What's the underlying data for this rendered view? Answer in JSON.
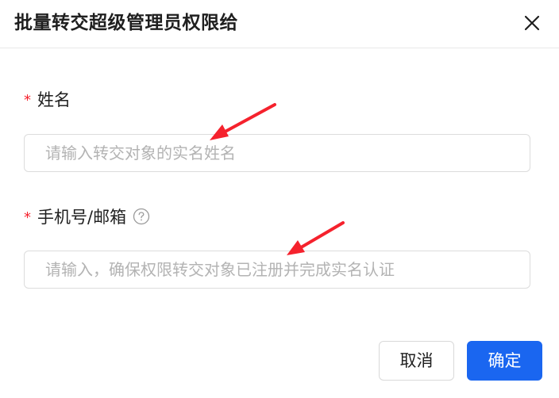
{
  "dialog": {
    "title": "批量转交超级管理员权限给",
    "close_icon": "close-icon"
  },
  "form": {
    "name_field": {
      "required_mark": "*",
      "label": "姓名",
      "placeholder": "请输入转交对象的实名姓名",
      "value": ""
    },
    "contact_field": {
      "required_mark": "*",
      "label": "手机号/邮箱",
      "help_icon": "question-circle-icon",
      "placeholder": "请输入，确保权限转交对象已注册并完成实名认证",
      "value": ""
    }
  },
  "footer": {
    "cancel_label": "取消",
    "confirm_label": "确定"
  },
  "annotations": {
    "arrow_color": "#f5222d"
  },
  "colors": {
    "primary": "#1a66f0",
    "required": "#f5222d"
  }
}
